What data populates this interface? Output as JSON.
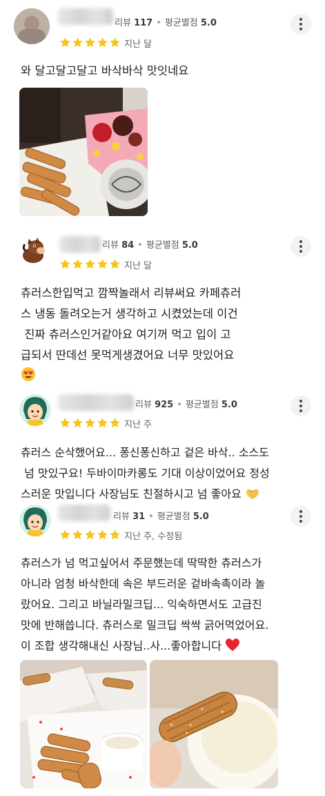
{
  "reviews": [
    {
      "review_count_label": "리뷰",
      "review_count": "117",
      "avg_label": "평균별점",
      "avg_score": "5.0",
      "time": "지난 달",
      "text": "와 달고달고달고 바삭바삭 맛잇네요",
      "rating": 5
    },
    {
      "review_count_label": "리뷰",
      "review_count": "84",
      "avg_label": "평균별점",
      "avg_score": "5.0",
      "time": "지난 달",
      "lines": [
        "츄러스한입먹고 깜짝놀래서 리뷰써요 카페츄러",
        "스 냉동 돌려오는거 생각하고 시켰었는데 이건",
        " 진짜 츄러스인거같아요 여기꺼 먹고 입이 고",
        "급되서 딴데선 못먹게생겼어요 너무 맛있어요"
      ],
      "rating": 5
    },
    {
      "review_count_label": "리뷰",
      "review_count": "925",
      "avg_label": "평균별점",
      "avg_score": "5.0",
      "time": "지난 주",
      "lines": [
        "츄러스 순삭했어요... 퐁신퐁신하고 겉은 바삭.. 소스도",
        " 넘 맛있구요! 두바이마카롱도 기대 이상이었어요 정성",
        "스러운 맛입니다 사장님도 친절하시고 넘 좋아요"
      ],
      "rating": 5
    },
    {
      "review_count_label": "리뷰",
      "review_count": "31",
      "avg_label": "평균별점",
      "avg_score": "5.0",
      "time": "지난 주, 수정됨",
      "lines": [
        "츄러스가 넘 먹고싶어서 주문했는데 딱딱한 츄러스가",
        "아니라 엄청 바삭한데 속은 부드러운 겉바속촉이라 놀",
        "랐어요. 그리고 바닐라밀크딥... 익숙하면서도 고급진",
        "맛에 반해씁니다. 츄러스로 밀크딥 싹싹 긁어먹었어요.",
        "이 조합 생각해내신 사장님..사...좋아합니다"
      ],
      "rating": 5
    }
  ],
  "colors": {
    "star": "#f5c518",
    "text": "#1f1f1f",
    "meta": "#5f5f5f",
    "heart": "#e8242d"
  },
  "icons": {
    "more": "more-vert-icon",
    "star": "star-icon"
  }
}
